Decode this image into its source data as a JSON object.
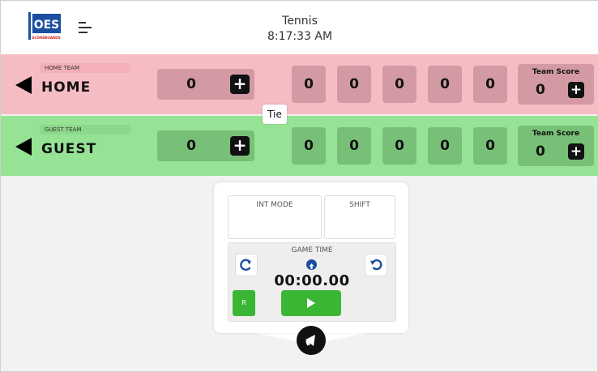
{
  "header": {
    "logo_text": "OES",
    "logo_subtext": "SCOREBOARDS",
    "sport": "Tennis",
    "time": "8:17:33 AM"
  },
  "icons": [
    "menu-icon",
    "arrow-left-icon",
    "plus-icon",
    "refresh-icon",
    "undo-icon",
    "up-arrow-icon",
    "play-icon",
    "horn-icon"
  ],
  "colors": {
    "home_bg": "#f6bcc4",
    "guest_bg": "#97e396",
    "accent_green": "#3ab634",
    "accent_blue": "#1a4fa0"
  },
  "home": {
    "label": "HOME TEAM",
    "name": "HOME",
    "score": "0",
    "sets": [
      "0",
      "0",
      "0",
      "0",
      "0"
    ],
    "team_score_label": "Team Score",
    "team_score": "0"
  },
  "guest": {
    "label": "GUEST TEAM",
    "name": "GUEST",
    "score": "0",
    "sets": [
      "0",
      "0",
      "0",
      "0",
      "0"
    ],
    "team_score_label": "Team Score",
    "team_score": "0"
  },
  "tie": "Tie",
  "control": {
    "int_mode": "INT MODE",
    "shift": "SHIFT",
    "game_time_label": "GAME TIME",
    "game_time": "00:00.00",
    "reset_label": "R"
  }
}
